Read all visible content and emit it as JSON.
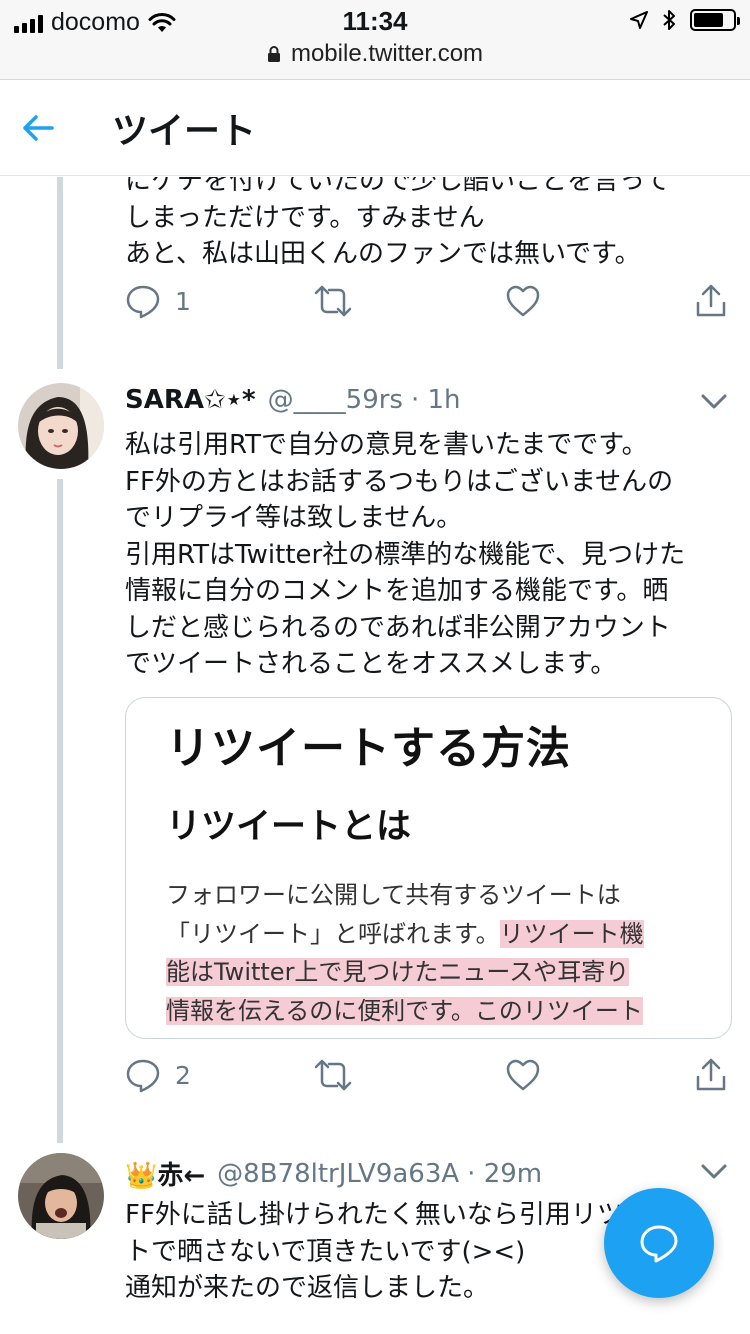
{
  "status_bar": {
    "carrier": "docomo",
    "time": "11:34",
    "battery_level": 0.75
  },
  "browser": {
    "url": "mobile.twitter.com"
  },
  "header": {
    "title": "ツイート"
  },
  "tweets": [
    {
      "text_lines": [
        "にケチを付けていたので少し酷いことを言って",
        "しまっただけです。すみません",
        "あと、私は山田くんのファンでは無いです。"
      ],
      "reply_count": "1"
    },
    {
      "name": "SARA✩⋆*",
      "handle": "@____59rs",
      "time": "1h",
      "text_lines": [
        "私は引用RTで自分の意見を書いたまでです。",
        "FF外の方とはお話するつもりはございませんの",
        "でリプライ等は致しません。",
        "引用RTはTwitter社の標準的な機能で、見つけた",
        "情報に自分のコメントを追加する機能です。晒",
        "しだと感じられるのであれば非公開アカウント",
        "でツイートされることをオススメします。"
      ],
      "card": {
        "heading": "リツイートする方法",
        "subheading": "リツイートとは",
        "para_line1": "フォロワーに公開して共有するツイートは",
        "para_line2_plain": "「リツイート」と呼ばれます。",
        "para_line2_hl": "リツイート機",
        "para_line3_hl": "能はTwitter上で見つけたニュースや耳寄り",
        "para_line4_hl": "情報を伝えるのに便利です。このリツイート"
      },
      "reply_count": "2"
    },
    {
      "name": "👑赤←",
      "handle": "@8B78ltrJLV9a63A",
      "time": "29m",
      "text_lines": [
        "FF外に話し掛けられたく無いなら引用リツイー",
        "トで晒さないで頂きたいです(><)",
        "通知が来たので返信しました。"
      ]
    }
  ],
  "colors": {
    "accent": "#1da1f2",
    "muted": "#657786",
    "highlight": "#e98ca0"
  },
  "icons": [
    "back-arrow-icon",
    "reply-icon",
    "retweet-icon",
    "like-icon",
    "share-icon",
    "chevron-down-icon",
    "compose-icon"
  ]
}
